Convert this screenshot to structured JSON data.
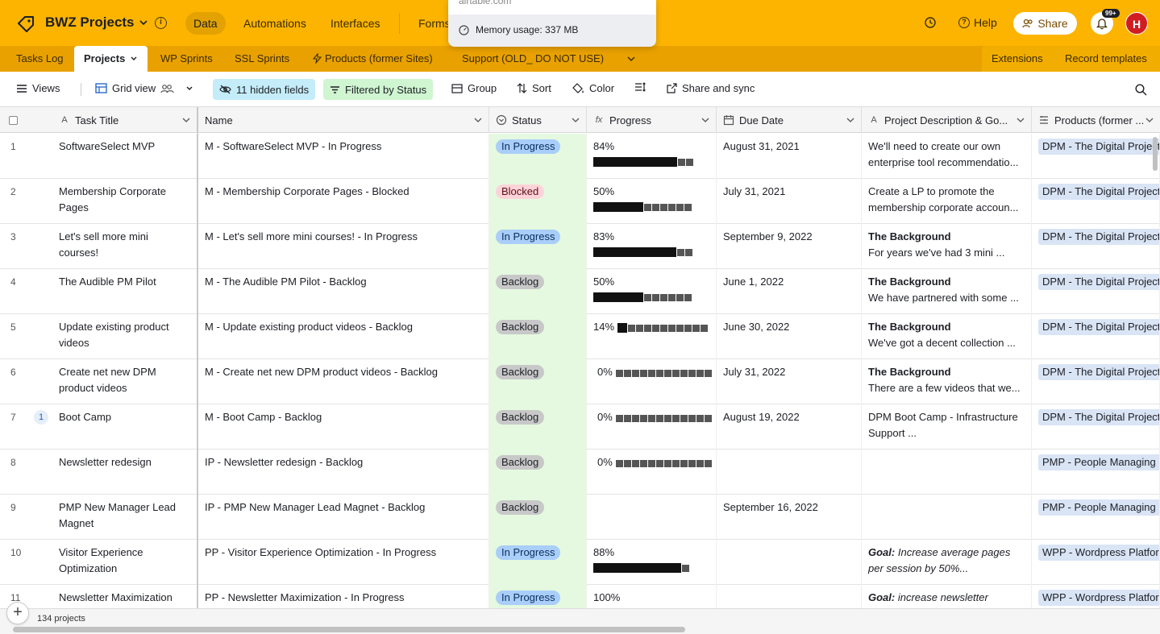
{
  "appbar": {
    "base_name": "BWZ Projects",
    "nav": [
      {
        "label": "Data",
        "active": true
      },
      {
        "label": "Automations",
        "active": false
      },
      {
        "label": "Interfaces",
        "active": false
      },
      {
        "label": "Forms",
        "active": false
      }
    ],
    "help_label": "Help",
    "share_label": "Share",
    "notifications_badge": "99+",
    "avatar_initial": "H",
    "accent_color": "#fcb400"
  },
  "popup": {
    "faded_text": "airtable.com",
    "memory_label": "Memory usage: 337 MB"
  },
  "tabs": {
    "items": [
      {
        "label": "Tasks Log",
        "active": false
      },
      {
        "label": "Projects",
        "active": true
      },
      {
        "label": "WP Sprints",
        "active": false
      },
      {
        "label": "SSL Sprints",
        "active": false
      },
      {
        "label": "Products (former Sites)",
        "active": false
      },
      {
        "label": "Support (OLD_ DO NOT USE)",
        "active": false
      }
    ],
    "extensions_label": "Extensions",
    "record_templates_label": "Record templates"
  },
  "toolbar": {
    "views_label": "Views",
    "view_name": "Grid view",
    "hidden_fields_label": "11 hidden fields",
    "filter_label": "Filtered by Status",
    "group_label": "Group",
    "sort_label": "Sort",
    "color_label": "Color",
    "share_sync_label": "Share and sync"
  },
  "grid": {
    "columns": [
      "Task Title",
      "Name",
      "Status",
      "Progress",
      "Due Date",
      "Project Description & Go...",
      "Products (former ..."
    ],
    "rows": [
      {
        "num": "1",
        "title": "SoftwareSelect MVP",
        "name": "M - SoftwareSelect MVP - In Progress",
        "status": "In Progress",
        "status_key": "inprogress",
        "progress_label": "84%",
        "progress": 0.84,
        "due": "August 31, 2021",
        "desc1": "We'll need to create our own",
        "desc2": "enterprise tool recommendatio...",
        "desc_style": "plain",
        "product": "DPM - The Digital Project"
      },
      {
        "num": "2",
        "title": "Membership Corporate Pages",
        "name": "M - Membership Corporate Pages - Blocked",
        "status": "Blocked",
        "status_key": "blocked",
        "progress_label": "50%",
        "progress": 0.5,
        "due": "July 31, 2021",
        "desc1": "Create a LP to promote the",
        "desc2": "membership corporate accoun...",
        "desc_style": "plain",
        "product": "DPM - The Digital Project"
      },
      {
        "num": "3",
        "title": "Let's sell more mini courses!",
        "name": "M - Let's sell more mini courses! - In Progress",
        "status": "In Progress",
        "status_key": "inprogress",
        "progress_label": "83%",
        "progress": 0.83,
        "due": "September 9, 2022",
        "desc1": "The Background",
        "desc2": "For years we've had 3 mini ...",
        "desc_style": "bold",
        "product": "DPM - The Digital Project"
      },
      {
        "num": "4",
        "title": "The Audible PM Pilot",
        "name": "M - The Audible PM Pilot - Backlog",
        "status": "Backlog",
        "status_key": "backlog",
        "progress_label": "50%",
        "progress": 0.5,
        "due": "June 1, 2022",
        "desc1": "The Background",
        "desc2": "We have partnered with some ...",
        "desc_style": "bold",
        "product": "DPM - The Digital Project"
      },
      {
        "num": "5",
        "title": "Update existing product videos",
        "name": "M - Update existing product videos - Backlog",
        "status": "Backlog",
        "status_key": "backlog",
        "progress_label": "14%",
        "progress": 0.14,
        "due": "June 30, 2022",
        "desc1": "The Background",
        "desc2": "We've got a decent collection ...",
        "desc_style": "bold",
        "product": "DPM - The Digital Project"
      },
      {
        "num": "6",
        "title": "Create net new DPM product videos",
        "name": "M - Create net new DPM product videos - Backlog",
        "status": "Backlog",
        "status_key": "backlog",
        "progress_label": "0%",
        "progress": 0,
        "due": "July 31, 2022",
        "desc1": "The Background",
        "desc2": "There are a few videos that we...",
        "desc_style": "bold",
        "product": "DPM - The Digital Project"
      },
      {
        "num": "7",
        "title": "Boot Camp",
        "name": "M - Boot Camp - Backlog",
        "status": "Backlog",
        "status_key": "backlog",
        "progress_label": "0%",
        "progress": 0,
        "due": "August 19, 2022",
        "desc1": "DPM Boot Camp - Infrastructure",
        "desc2": "Support ...",
        "desc_style": "plain",
        "product": "DPM - The Digital Project",
        "comments": "1"
      },
      {
        "num": "8",
        "title": "Newsletter redesign",
        "name": "IP - Newsletter redesign - Backlog",
        "status": "Backlog",
        "status_key": "backlog",
        "progress_label": "0%",
        "progress": 0,
        "due": "",
        "desc1": "",
        "desc2": "",
        "desc_style": "plain",
        "product": "PMP - People Managing P"
      },
      {
        "num": "9",
        "title": "PMP New Manager Lead Magnet",
        "name": "IP - PMP New Manager Lead Magnet - Backlog",
        "status": "Backlog",
        "status_key": "backlog",
        "progress_label": "",
        "progress": null,
        "due": "September 16, 2022",
        "desc1": "",
        "desc2": "",
        "desc_style": "plain",
        "product": "PMP - People Managing P"
      },
      {
        "num": "10",
        "title": "Visitor Experience Optimization",
        "name": "PP - Visitor Experience Optimization - In Progress",
        "status": "In Progress",
        "status_key": "inprogress",
        "progress_label": "88%",
        "progress": 0.88,
        "due": "",
        "desc1_bold": "Goal:",
        "desc1": " Increase average pages",
        "desc2": "per session by 50%...",
        "desc_style": "italic",
        "product": "WPP - Wordpress Platfor"
      },
      {
        "num": "11",
        "title": "Newsletter Maximization",
        "name": "PP - Newsletter Maximization - In Progress",
        "status": "In Progress",
        "status_key": "inprogress",
        "progress_label": "100%",
        "progress": 1,
        "due": "",
        "desc1_bold": "Goal:",
        "desc1": " increase newsletter",
        "desc2": "",
        "desc_style": "italic",
        "product": "WPP - Wordpress Platfor"
      }
    ]
  },
  "footer": {
    "record_count": "134 projects"
  }
}
